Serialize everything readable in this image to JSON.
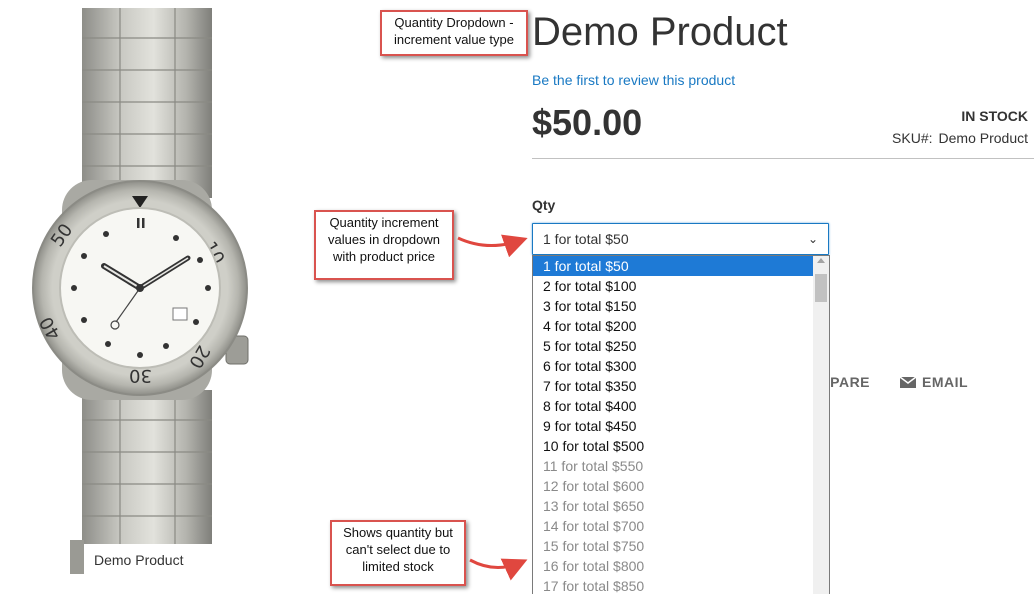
{
  "gallery": {
    "image_label": "watch-product-image",
    "caption": "Demo Product"
  },
  "annotations": {
    "dropdown_type": "Quantity Dropdown - increment value type",
    "increment_values": "Quantity increment values in dropdown with product price",
    "limited_stock": "Shows quantity but can't select due to limited stock"
  },
  "product": {
    "title": "Demo Product",
    "review_link": "Be the first to review this product",
    "price": "$50.00",
    "stock_status": "IN STOCK",
    "sku_label": "SKU#:",
    "sku_value": "Demo Product"
  },
  "qty": {
    "label": "Qty",
    "selected": "1 for total $50",
    "options": [
      {
        "label": "1 for total $50",
        "state": "selected"
      },
      {
        "label": "2 for total $100",
        "state": "enabled"
      },
      {
        "label": "3 for total $150",
        "state": "enabled"
      },
      {
        "label": "4 for total $200",
        "state": "enabled"
      },
      {
        "label": "5 for total $250",
        "state": "enabled"
      },
      {
        "label": "6 for total $300",
        "state": "enabled"
      },
      {
        "label": "7 for total $350",
        "state": "enabled"
      },
      {
        "label": "8 for total $400",
        "state": "enabled"
      },
      {
        "label": "9 for total $450",
        "state": "enabled"
      },
      {
        "label": "10 for total $500",
        "state": "enabled"
      },
      {
        "label": "11 for total $550",
        "state": "disabled"
      },
      {
        "label": "12 for total $600",
        "state": "disabled"
      },
      {
        "label": "13 for total $650",
        "state": "disabled"
      },
      {
        "label": "14 for total $700",
        "state": "disabled"
      },
      {
        "label": "15 for total $750",
        "state": "disabled"
      },
      {
        "label": "16 for total $800",
        "state": "disabled"
      },
      {
        "label": "17 for total $850",
        "state": "disabled"
      }
    ]
  },
  "actions": {
    "compare_label": "MPARE",
    "email_label": "EMAIL",
    "email_icon": "envelope-icon"
  },
  "colors": {
    "annotation_border": "#d9534f",
    "link": "#1979c3",
    "selected_option": "#1e7ad6",
    "disabled_option": "#8a8a8a"
  }
}
